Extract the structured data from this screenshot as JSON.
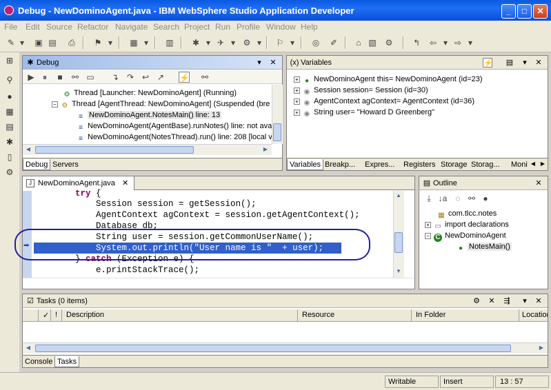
{
  "window": {
    "title": "Debug - NewDominoAgent.java - IBM WebSphere Studio Application Developer",
    "minimize_glyph": "_",
    "maximize_glyph": "□",
    "close_glyph": "✕"
  },
  "menu": [
    "File",
    "Edit",
    "Source",
    "Refactor",
    "Navigate",
    "Search",
    "Project",
    "Run",
    "Profile",
    "Window",
    "Help"
  ],
  "debug_view": {
    "title": "Debug",
    "threads": [
      {
        "label": "Thread [Launcher: NewDominoAgent] (Running)"
      },
      {
        "label": "Thread [AgentThread: NewDominoAgent] (Suspended (bre"
      }
    ],
    "frames": [
      {
        "label": "NewDominoAgent.NotesMain() line: 13"
      },
      {
        "label": "NewDominoAgent(AgentBase).runNotes() line: not ava"
      },
      {
        "label": "NewDominoAgent(NotesThread).run() line: 208 [local v"
      }
    ],
    "tabs": [
      "Debug",
      "Servers"
    ],
    "selected_tab": "Debug"
  },
  "variables_view": {
    "title": "Variables",
    "rows": [
      {
        "label": "NewDominoAgent this= NewDominoAgent  (id=23)"
      },
      {
        "label": "Session session= Session  (id=30)"
      },
      {
        "label": "AgentContext agContext= AgentContext  (id=36)"
      },
      {
        "label": "String user= \"Howard D Greenberg\""
      }
    ],
    "tabs": [
      "Variables",
      "Breakp...",
      "Expres...",
      "Registers",
      "Storage",
      "Storag...",
      "Moni"
    ],
    "selected_tab": "Variables"
  },
  "editor": {
    "tab_label": "NewDominoAgent.java",
    "lines": [
      {
        "pre": "        ",
        "kw": "try",
        "post": " {"
      },
      {
        "pre": "            Session session = getSession();"
      },
      {
        "pre": "            AgentContext agContext = session.getAgentContext();"
      },
      {
        "pre": "            Database db;"
      },
      {
        "pre": "            String user = session.getCommonUserName();"
      },
      {
        "pre": "            System.out.println(",
        "str": "\"User name is \"",
        "post": "  + user);"
      },
      {
        "pre": "        } ",
        "kw": "catch",
        "post": " (Exception e) {"
      },
      {
        "pre": "            e.printStackTrace();"
      }
    ]
  },
  "outline_view": {
    "title": "Outline",
    "items": [
      {
        "label": "com.tlcc.notes"
      },
      {
        "label": "import declarations"
      },
      {
        "label": "NewDominoAgent"
      },
      {
        "label": "NotesMain()"
      }
    ]
  },
  "tasks_view": {
    "title": "Tasks (0 items)",
    "columns": [
      "✓",
      "!",
      "Description",
      "Resource",
      "In Folder",
      "Location"
    ],
    "tabs": [
      "Console",
      "Tasks"
    ],
    "selected_tab": "Tasks"
  },
  "status_bar": {
    "mode": "Writable",
    "insert": "Insert",
    "position": "13 : 57"
  },
  "colors": {
    "title_bar": "#1f6ef5",
    "selection": "#3060c8",
    "annotation_ellipse": "#2020a0",
    "keyword": "#7f0055",
    "string": "#2a00ff"
  }
}
